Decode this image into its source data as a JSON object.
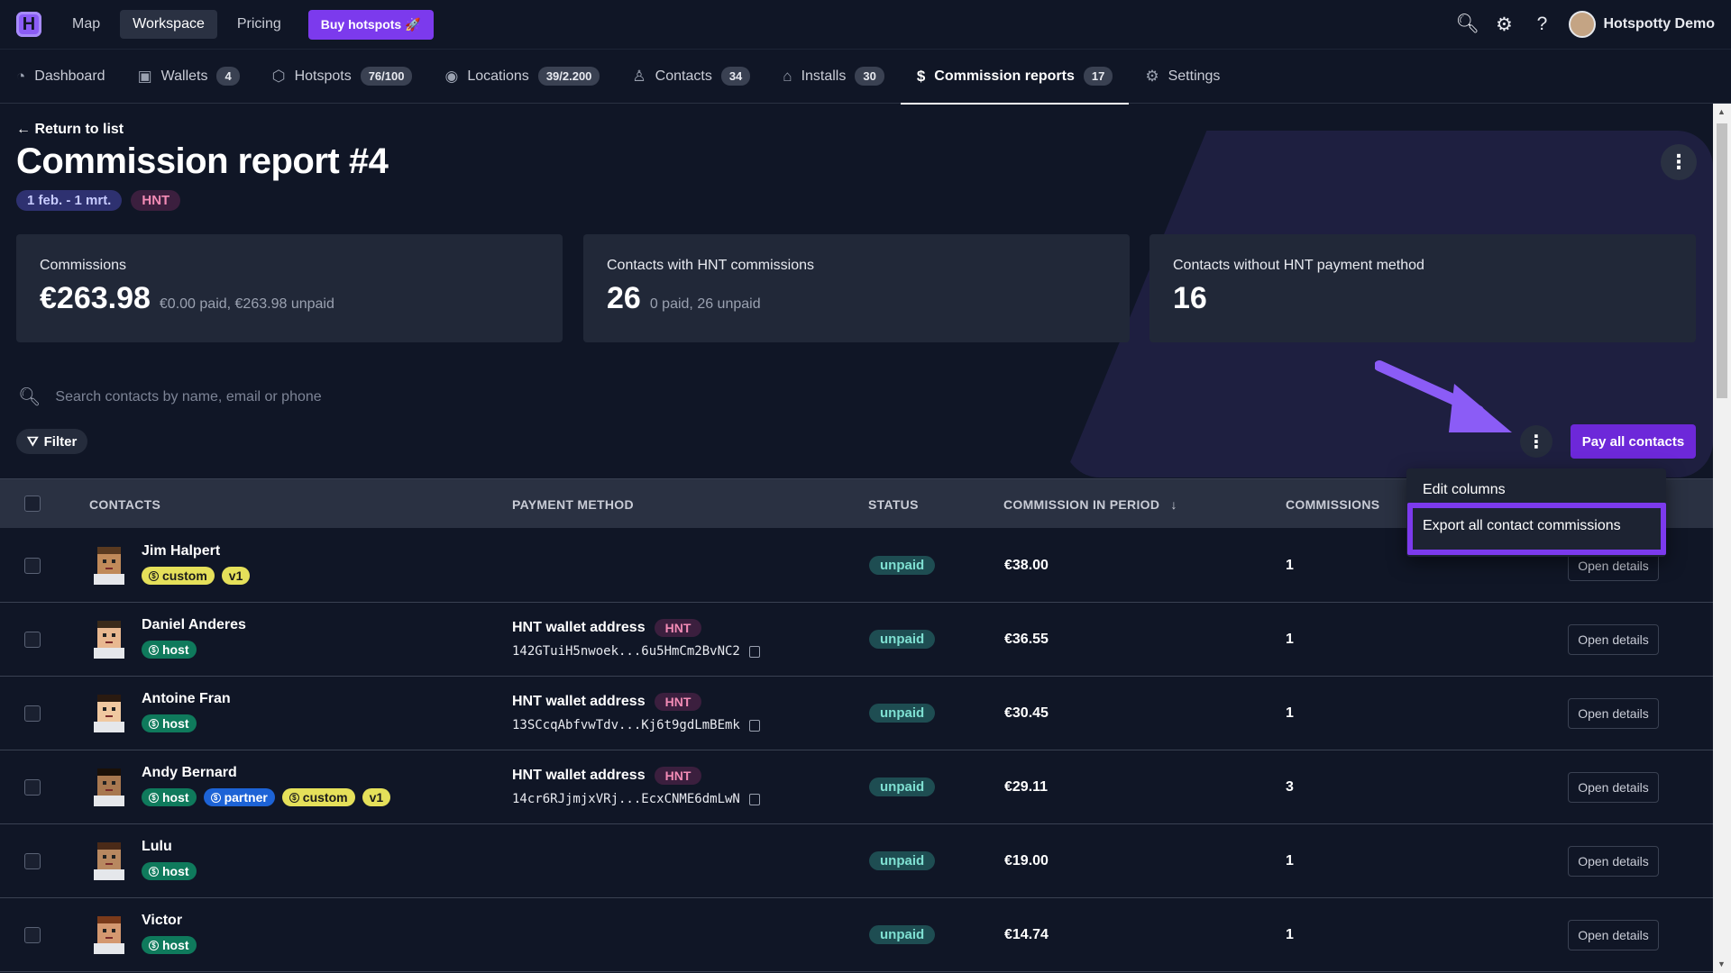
{
  "topbar": {
    "logo": "H",
    "nav": [
      "Map",
      "Workspace",
      "Pricing"
    ],
    "buy_label": "Buy hotspots",
    "user_name": "Hotspotty Demo"
  },
  "subnav": [
    {
      "label": "Dashboard",
      "icon": "pie-chart-icon"
    },
    {
      "label": "Wallets",
      "badge": "4",
      "icon": "wallet-icon"
    },
    {
      "label": "Hotspots",
      "badge": "76/100",
      "icon": "cube-icon"
    },
    {
      "label": "Locations",
      "badge": "39/2.200",
      "icon": "pin-icon"
    },
    {
      "label": "Contacts",
      "badge": "34",
      "icon": "user-icon"
    },
    {
      "label": "Installs",
      "badge": "30",
      "icon": "home-icon"
    },
    {
      "label": "Commission reports",
      "badge": "17",
      "icon": "dollar-icon"
    },
    {
      "label": "Settings",
      "icon": "gear-icon"
    }
  ],
  "header": {
    "back": "Return to list",
    "title": "Commission report #4",
    "date_chip": "1 feb. - 1 mrt.",
    "token_chip": "HNT"
  },
  "cards": [
    {
      "label": "Commissions",
      "value": "€263.98",
      "sub": "€0.00 paid, €263.98 unpaid"
    },
    {
      "label": "Contacts with HNT commissions",
      "value": "26",
      "sub": "0 paid, 26 unpaid"
    },
    {
      "label": "Contacts without HNT payment method",
      "value": "16",
      "sub": ""
    }
  ],
  "search": {
    "placeholder": "Search contacts by name, email or phone"
  },
  "filter_label": "Filter",
  "pay_all_label": "Pay all contacts",
  "dropdown": {
    "items": [
      "Edit columns",
      "Export all contact commissions"
    ]
  },
  "table": {
    "headers": [
      "CONTACTS",
      "PAYMENT METHOD",
      "STATUS",
      "COMMISSION IN PERIOD",
      "COMMISSIONS"
    ],
    "open_label": "Open details",
    "rows": [
      {
        "name": "Jim Halpert",
        "tags": [
          "custom",
          "v1"
        ],
        "pm": "",
        "pm_token": "",
        "address": "",
        "status": "unpaid",
        "amount": "€38.00",
        "count": "1"
      },
      {
        "name": "Daniel Anderes",
        "tags": [
          "host"
        ],
        "pm": "HNT wallet address",
        "pm_token": "HNT",
        "address": "142GTuiH5nwoek...6u5HmCm2BvNC2",
        "status": "unpaid",
        "amount": "€36.55",
        "count": "1"
      },
      {
        "name": "Antoine Fran",
        "tags": [
          "host"
        ],
        "pm": "HNT wallet address",
        "pm_token": "HNT",
        "address": "13SCcqAbfvwTdv...Kj6t9gdLmBEmk",
        "status": "unpaid",
        "amount": "€30.45",
        "count": "1"
      },
      {
        "name": "Andy Bernard",
        "tags": [
          "host",
          "partner",
          "custom",
          "v1"
        ],
        "pm": "HNT wallet address",
        "pm_token": "HNT",
        "address": "14cr6RJjmjxVRj...EcxCNME6dmLwN",
        "status": "unpaid",
        "amount": "€29.11",
        "count": "3"
      },
      {
        "name": "Lulu",
        "tags": [
          "host"
        ],
        "pm": "",
        "pm_token": "",
        "address": "",
        "status": "unpaid",
        "amount": "€19.00",
        "count": "1"
      },
      {
        "name": "Victor",
        "tags": [
          "host"
        ],
        "pm": "",
        "pm_token": "",
        "address": "",
        "status": "unpaid",
        "amount": "€14.74",
        "count": "1"
      }
    ]
  },
  "colors": {
    "accent": "#7c3aed",
    "background": "#101626",
    "card": "#212838"
  }
}
